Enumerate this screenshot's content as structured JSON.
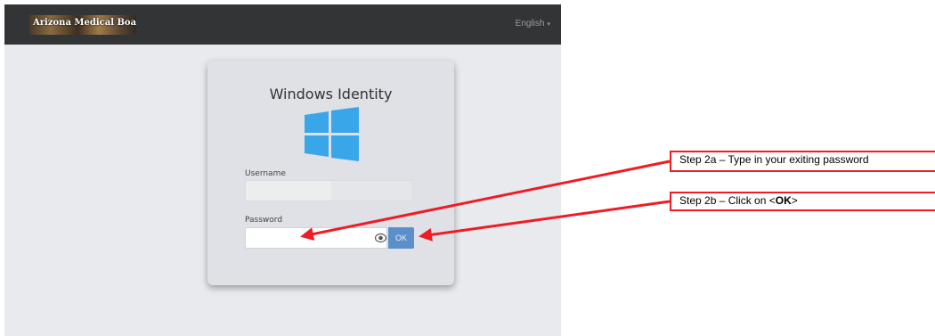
{
  "navbar": {
    "brand": "Arizona Medical Board",
    "language": "English",
    "language_caret": "▾"
  },
  "login": {
    "title": "Windows Identity",
    "username_label": "Username",
    "username_value": "",
    "password_label": "Password",
    "password_value": "",
    "ok_label": "OK",
    "logo_color": "#3aa6ea"
  },
  "annotations": {
    "step_2a": "Step 2a – Type in your exiting password",
    "step_2b_prefix": "Step 2b – Click on <",
    "step_2b_bold": "OK",
    "step_2b_suffix": ">",
    "arrow_color": "#ee1c25"
  }
}
